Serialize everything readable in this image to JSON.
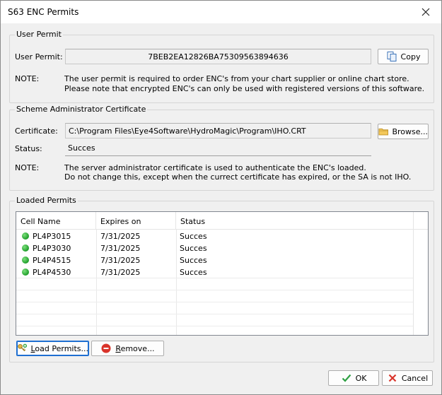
{
  "window": {
    "title": "S63 ENC Permits"
  },
  "user_permit": {
    "group_label": "User Permit",
    "field_label": "User Permit:",
    "value": "7BEB2EA12826BA75309563894636",
    "copy_label": "Copy",
    "note_label": "NOTE:",
    "note_line1": "The user permit is required to order ENC's from your chart supplier or online chart store.",
    "note_line2": "Please note that encrypted ENC's can only be used with registered versions of this software."
  },
  "certificate": {
    "group_label": "Scheme Administrator Certificate",
    "cert_label": "Certificate:",
    "cert_value": "C:\\Program Files\\Eye4Software\\HydroMagic\\Program\\IHO.CRT",
    "browse_label": "Browse...",
    "status_label": "Status:",
    "status_value": "Succes",
    "note_label": "NOTE:",
    "note_line1": "The server administrator certificate is used to authenticate the ENC's loaded.",
    "note_line2": "Do not change this, except when the currect certificate has expired, or the SA is not IHO."
  },
  "loaded_permits": {
    "group_label": "Loaded Permits",
    "columns": [
      "Cell Name",
      "Expires on",
      "Status"
    ],
    "rows": [
      {
        "cell": "PL4P3015",
        "expires": "7/31/2025",
        "status": "Succes"
      },
      {
        "cell": "PL4P3030",
        "expires": "7/31/2025",
        "status": "Succes"
      },
      {
        "cell": "PL4P4515",
        "expires": "7/31/2025",
        "status": "Succes"
      },
      {
        "cell": "PL4P4530",
        "expires": "7/31/2025",
        "status": "Succes"
      }
    ],
    "load_label_prefix": "L",
    "load_label_rest": "oad Permits...",
    "remove_label_prefix": "R",
    "remove_label_rest": "emove..."
  },
  "footer": {
    "ok_label": "OK",
    "cancel_label": "Cancel"
  },
  "colors": {
    "accent": "#1e6fd1",
    "status_ok": "#1e9e2a",
    "remove_red": "#d9342b"
  }
}
